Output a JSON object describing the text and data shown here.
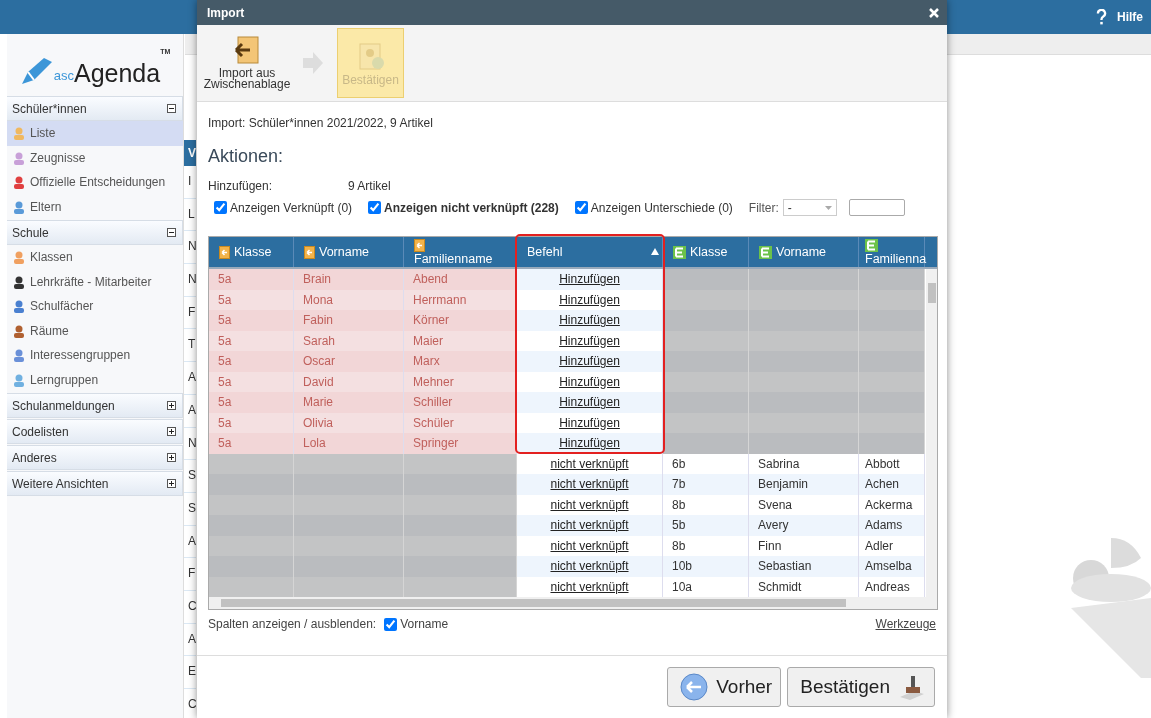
{
  "topbar": {
    "help": "Hilfe"
  },
  "logo": {
    "prefix": "asc",
    "name": "Agenda",
    "mark": "TM"
  },
  "sidebar": {
    "sections": [
      {
        "title": "Schüler*innen",
        "expanded": true,
        "items": [
          {
            "label": "Liste",
            "selected": true
          },
          {
            "label": "Zeugnisse",
            "selected": false
          },
          {
            "label": "Offizielle Entscheidungen",
            "selected": false
          },
          {
            "label": "Eltern",
            "selected": false
          }
        ]
      },
      {
        "title": "Schule",
        "expanded": true,
        "items": [
          {
            "label": "Klassen",
            "selected": false
          },
          {
            "label": "Lehrkräfte - Mitarbeiter",
            "selected": false
          },
          {
            "label": "Schulfächer",
            "selected": false
          },
          {
            "label": "Räume",
            "selected": false
          },
          {
            "label": "Interessengruppen",
            "selected": false
          },
          {
            "label": "Lerngruppen",
            "selected": false
          }
        ]
      },
      {
        "title": "Schulanmeldungen",
        "expanded": false
      },
      {
        "title": "Codelisten",
        "expanded": false
      },
      {
        "title": "Anderes",
        "expanded": false
      },
      {
        "title": "Weitere Ansichten",
        "expanded": false
      }
    ]
  },
  "background_list": {
    "header": "V",
    "rows": [
      "I",
      "L",
      "N",
      "N",
      "F",
      "T",
      "A",
      "A",
      "N",
      "S",
      "S",
      "A",
      "F",
      "C",
      "A",
      "E",
      "C"
    ]
  },
  "dialog": {
    "title": "Import",
    "toolbar": [
      {
        "label": "Import aus Zwischenablage",
        "disabled": false,
        "selected": false
      },
      {
        "label": "Bestätigen",
        "disabled": true,
        "selected": true
      }
    ],
    "info": "Import: Schüler*innen 2021/2022, 9 Artikel",
    "heading": "Aktionen:",
    "summary": {
      "label": "Hinzufügen:",
      "value": "9 Artikel"
    },
    "filters": [
      {
        "label": "Anzeigen Verknüpft (0)",
        "checked": true,
        "bold": false
      },
      {
        "label": "Anzeigen nicht verknüpft (228)",
        "checked": true,
        "bold": true
      },
      {
        "label": "Anzeigen Unterschiede (0)",
        "checked": true,
        "bold": false
      }
    ],
    "filter": {
      "label": "Filter:",
      "value": "-"
    },
    "table": {
      "columns": [
        {
          "label": "Klasse",
          "kind": "import",
          "sorted": false
        },
        {
          "label": "Vorname",
          "kind": "import",
          "sorted": false
        },
        {
          "label": "Familienname",
          "kind": "import",
          "sorted": false
        },
        {
          "label": "Befehl",
          "kind": "command",
          "sorted": true
        },
        {
          "label": "Klasse",
          "kind": "existing",
          "sorted": false
        },
        {
          "label": "Vorname",
          "kind": "existing",
          "sorted": false
        },
        {
          "label": "Familienna",
          "kind": "existing",
          "sorted": false
        }
      ],
      "rows": [
        {
          "kind": "import",
          "cells": [
            "5a",
            "Brain",
            "Abend",
            "Hinzufügen"
          ]
        },
        {
          "kind": "import",
          "cells": [
            "5a",
            "Mona",
            "Herrmann",
            "Hinzufügen"
          ]
        },
        {
          "kind": "import",
          "cells": [
            "5a",
            "Fabin",
            "Körner",
            "Hinzufügen"
          ]
        },
        {
          "kind": "import",
          "cells": [
            "5a",
            "Sarah",
            "Maier",
            "Hinzufügen"
          ]
        },
        {
          "kind": "import",
          "cells": [
            "5a",
            "Oscar",
            "Marx",
            "Hinzufügen"
          ]
        },
        {
          "kind": "import",
          "cells": [
            "5a",
            "David",
            "Mehner",
            "Hinzufügen"
          ]
        },
        {
          "kind": "import",
          "cells": [
            "5a",
            "Marie",
            "Schiller",
            "Hinzufügen"
          ]
        },
        {
          "kind": "import",
          "cells": [
            "5a",
            "Olivia",
            "Schüler",
            "Hinzufügen"
          ]
        },
        {
          "kind": "import",
          "cells": [
            "5a",
            "Lola",
            "Springer",
            "Hinzufügen"
          ]
        },
        {
          "kind": "existing",
          "cells": [
            "nicht verknüpft",
            "6b",
            "Sabrina",
            "Abbott"
          ]
        },
        {
          "kind": "existing",
          "cells": [
            "nicht verknüpft",
            "7b",
            "Benjamin",
            "Achen"
          ]
        },
        {
          "kind": "existing",
          "cells": [
            "nicht verknüpft",
            "8b",
            "Svena",
            "Ackerma"
          ]
        },
        {
          "kind": "existing",
          "cells": [
            "nicht verknüpft",
            "5b",
            "Avery",
            "Adams"
          ]
        },
        {
          "kind": "existing",
          "cells": [
            "nicht verknüpft",
            "8b",
            "Finn",
            "Adler"
          ]
        },
        {
          "kind": "existing",
          "cells": [
            "nicht verknüpft",
            "10b",
            "Sebastian",
            "Amselba"
          ]
        },
        {
          "kind": "existing",
          "cells": [
            "nicht verknüpft",
            "10a",
            "Schmidt",
            "Andreas"
          ]
        }
      ]
    },
    "columns_toggle": {
      "label": "Spalten anzeigen / ausblenden:",
      "options": [
        {
          "label": "Vorname",
          "checked": true
        }
      ]
    },
    "tools_link": "Werkzeuge",
    "buttons": [
      {
        "label": "Vorher",
        "kind": "back"
      },
      {
        "label": "Bestätigen",
        "kind": "confirm"
      }
    ]
  }
}
